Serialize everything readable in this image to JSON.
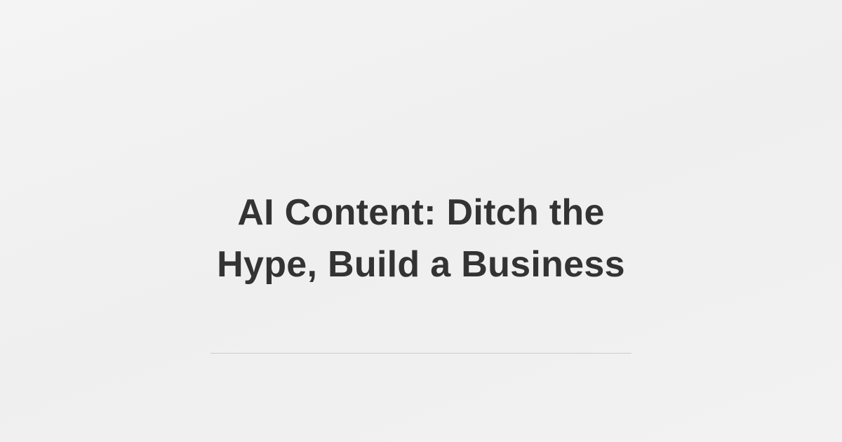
{
  "title": {
    "line1": "AI Content: Ditch the",
    "line2": "Hype, Build a Business"
  },
  "colors": {
    "background": "#f1f1f1",
    "title_text": "#333333",
    "divider": "#cccccc"
  }
}
